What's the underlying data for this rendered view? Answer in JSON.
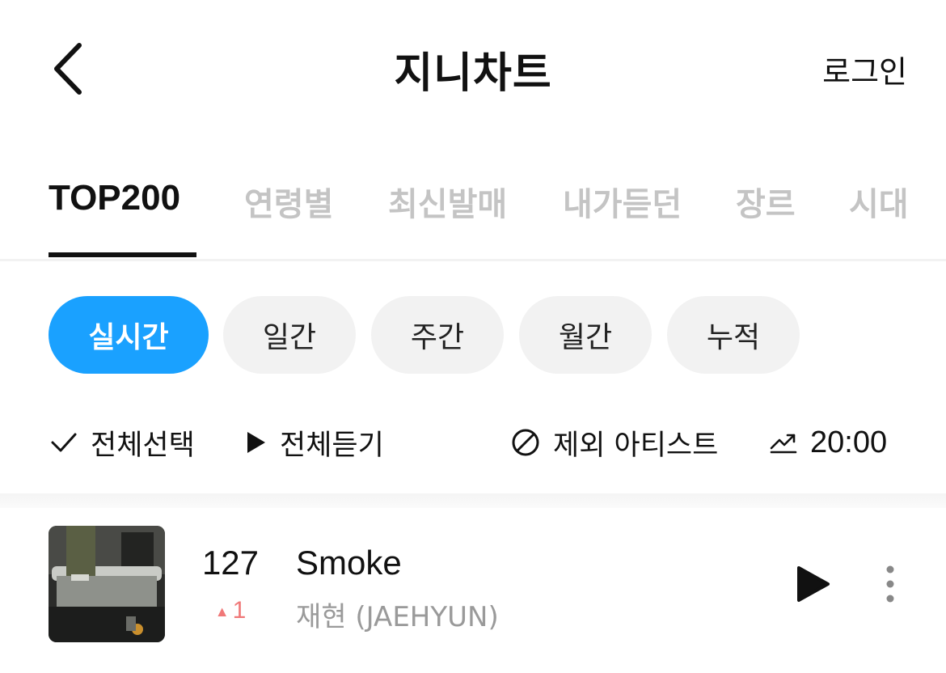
{
  "header": {
    "title": "지니차트",
    "login_label": "로그인"
  },
  "tabs": [
    {
      "label": "TOP200",
      "active": true
    },
    {
      "label": "연령별",
      "active": false
    },
    {
      "label": "최신발매",
      "active": false
    },
    {
      "label": "내가듣던",
      "active": false
    },
    {
      "label": "장르",
      "active": false
    },
    {
      "label": "시대",
      "active": false
    }
  ],
  "periods": [
    {
      "label": "실시간",
      "active": true
    },
    {
      "label": "일간",
      "active": false
    },
    {
      "label": "주간",
      "active": false
    },
    {
      "label": "월간",
      "active": false
    },
    {
      "label": "누적",
      "active": false
    }
  ],
  "actions": {
    "select_all": "전체선택",
    "play_all": "전체듣기",
    "exclude_artist": "제외 아티스트",
    "update_time": "20:00"
  },
  "songs": [
    {
      "rank": "127",
      "rank_change": "1",
      "rank_direction": "up",
      "title": "Smoke",
      "artist": "재현 (JAEHYUN)"
    }
  ],
  "colors": {
    "accent": "#1aa1ff",
    "rank_up": "#f07878",
    "inactive_tab": "#c4c4c4",
    "chip_bg": "#f2f2f2"
  },
  "icons": {
    "back": "chevron-left-icon",
    "select_all": "check-icon",
    "play_all": "play-icon",
    "exclude": "prohibit-icon",
    "trend": "trending-up-icon",
    "more": "more-vertical-icon"
  }
}
